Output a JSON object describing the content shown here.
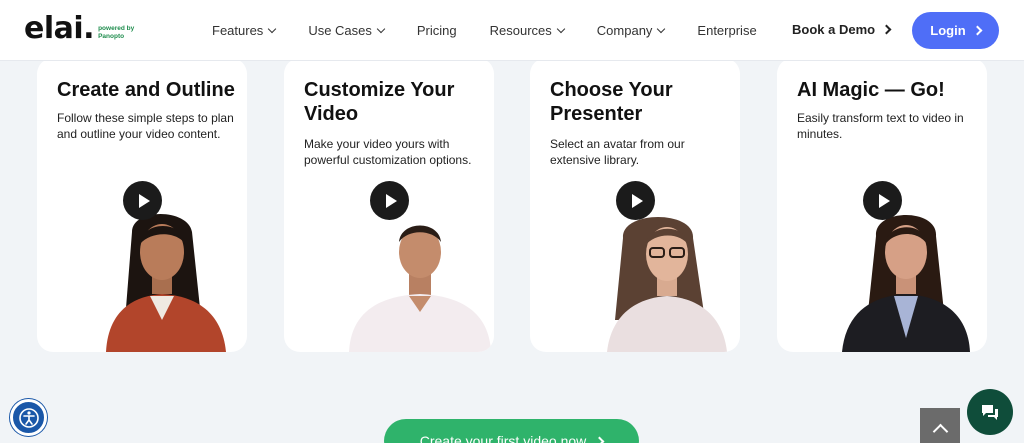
{
  "header": {
    "logo": {
      "word": "elai",
      "dot": ".",
      "powered_by": "powered by",
      "brand": "Panopto"
    },
    "nav": [
      {
        "label": "Features",
        "has_dropdown": true
      },
      {
        "label": "Use Cases",
        "has_dropdown": true
      },
      {
        "label": "Pricing",
        "has_dropdown": false
      },
      {
        "label": "Resources",
        "has_dropdown": true
      },
      {
        "label": "Company",
        "has_dropdown": true
      },
      {
        "label": "Enterprise",
        "has_dropdown": false
      }
    ],
    "book_demo": "Book a Demo",
    "login": "Login"
  },
  "cards": [
    {
      "title": "Create and Outline",
      "description": "Follow these simple steps to plan and outline your video content.",
      "presenter": "woman-red-top"
    },
    {
      "title": "Customize Your Video",
      "description": "Make your video yours with powerful customization options.",
      "presenter": "man-white-shirt"
    },
    {
      "title": "Choose Your Presenter",
      "description": "Select an avatar from our extensive library.",
      "presenter": "woman-glasses"
    },
    {
      "title": "AI Magic — Go!",
      "description": "Easily transform text to video in minutes.",
      "presenter": "woman-blazer"
    }
  ],
  "cta": {
    "label": "Create your first video now"
  },
  "icons": {
    "accessibility": "accessibility-icon",
    "scroll_top": "chevron-up-icon",
    "chat": "chat-icon",
    "play": "play-icon"
  },
  "colors": {
    "login_bg": "#4f6ef7",
    "cta_bg": "#2fb36b",
    "chat_bg": "#0f4d3a",
    "accessibility_bg": "#1a57a8",
    "logo_accent": "#1d8c4c"
  }
}
